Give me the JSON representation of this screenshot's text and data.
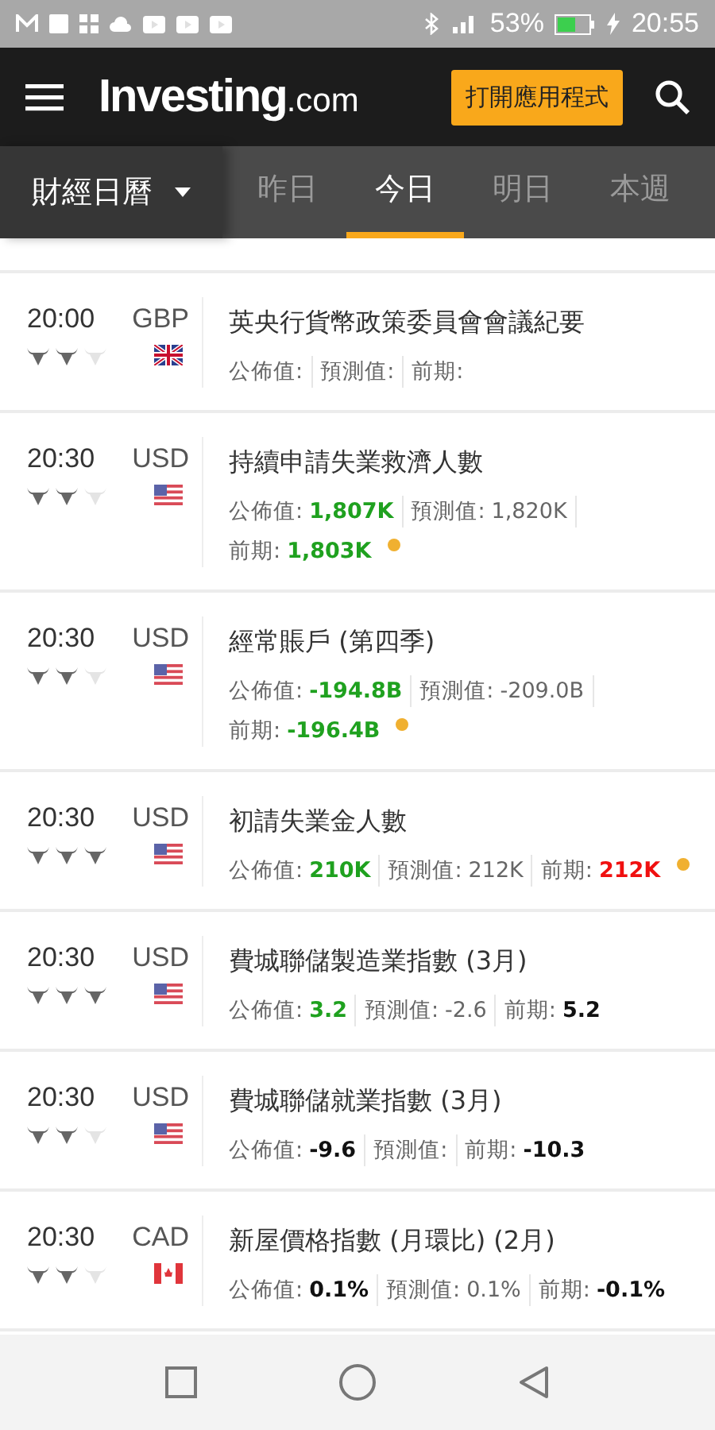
{
  "status_bar": {
    "battery": "53%",
    "time": "20:55"
  },
  "header": {
    "logo": "Investing",
    "logo_suffix": ".com",
    "open_app_button": "打開應用程式"
  },
  "section": {
    "title": "財經日曆"
  },
  "tabs": [
    {
      "label": "昨日",
      "selected": false
    },
    {
      "label": "今日",
      "selected": true
    },
    {
      "label": "明日",
      "selected": false
    },
    {
      "label": "本週",
      "selected": false
    }
  ],
  "events": [
    {
      "time": "20:00",
      "currency": "GBP",
      "flag": {
        "kind": "uk"
      },
      "stars": 2,
      "title": "英央行貨幣政策委員會會議紀要",
      "fields": [
        {
          "label": "公佈值:"
        },
        {
          "label": "預測值:"
        },
        {
          "label": "前期:"
        }
      ],
      "revised": false
    },
    {
      "time": "20:30",
      "currency": "USD",
      "flag": {
        "kind": "us"
      },
      "stars": 2,
      "title": "持續申請失業救濟人數",
      "fields": [
        {
          "label": "公佈值:",
          "value": "1,807K",
          "color": "#1fa11f"
        },
        {
          "label": "預測值:",
          "value": "1,820K",
          "color": "#666666"
        },
        {
          "label": "前期:",
          "value": "1,803K",
          "color": "#1fa11f"
        }
      ],
      "revised": true
    },
    {
      "time": "20:30",
      "currency": "USD",
      "flag": {
        "kind": "us"
      },
      "stars": 2,
      "title": "經常賬戶 (第四季)",
      "fields": [
        {
          "label": "公佈值:",
          "value": "-194.8B",
          "color": "#1fa11f"
        },
        {
          "label": "預測值:",
          "value": "-209.0B",
          "color": "#666666"
        },
        {
          "label": "前期:",
          "value": "-196.4B",
          "color": "#1fa11f"
        }
      ],
      "revised": true
    },
    {
      "time": "20:30",
      "currency": "USD",
      "flag": {
        "kind": "us"
      },
      "stars": 3,
      "title": "初請失業金人數",
      "fields": [
        {
          "label": "公佈值:",
          "value": "210K",
          "color": "#1fa11f"
        },
        {
          "label": "預測值:",
          "value": "212K",
          "color": "#666666"
        },
        {
          "label": "前期:",
          "value": "212K",
          "color": "#f01010"
        }
      ],
      "revised": true
    },
    {
      "time": "20:30",
      "currency": "USD",
      "flag": {
        "kind": "us"
      },
      "stars": 3,
      "title": "費城聯儲製造業指數 (3月)",
      "fields": [
        {
          "label": "公佈值:",
          "value": "3.2",
          "color": "#1fa11f"
        },
        {
          "label": "預測值:",
          "value": "-2.6",
          "color": "#666666"
        },
        {
          "label": "前期:",
          "value": "5.2",
          "color": "#111111"
        }
      ],
      "revised": false
    },
    {
      "time": "20:30",
      "currency": "USD",
      "flag": {
        "kind": "us"
      },
      "stars": 2,
      "title": "費城聯儲就業指數 (3月)",
      "fields": [
        {
          "label": "公佈值:",
          "value": "-9.6",
          "color": "#111111"
        },
        {
          "label": "預測值:"
        },
        {
          "label": "前期:",
          "value": "-10.3",
          "color": "#111111"
        }
      ],
      "revised": false
    },
    {
      "time": "20:30",
      "currency": "CAD",
      "flag": {
        "kind": "ca"
      },
      "stars": 2,
      "title": "新屋價格指數 (月環比) (2月)",
      "fields": [
        {
          "label": "公佈值:",
          "value": "0.1%",
          "color": "#111111"
        },
        {
          "label": "預測值:",
          "value": "0.1%",
          "color": "#666666"
        },
        {
          "label": "前期:",
          "value": "-0.1%",
          "color": "#111111"
        }
      ],
      "revised": false
    }
  ]
}
